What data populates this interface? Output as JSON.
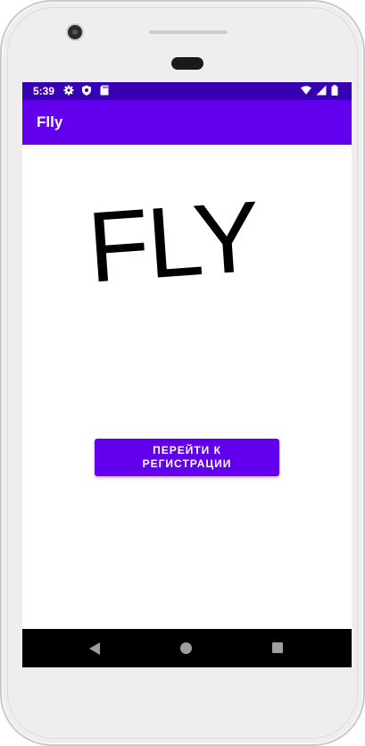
{
  "status_bar": {
    "time": "5:39",
    "left_icons": [
      "gear-icon",
      "shield-icon",
      "sdcard-icon"
    ],
    "right_icons": [
      "wifi-icon",
      "signal-icon",
      "battery-icon"
    ],
    "background": "#3700b3"
  },
  "app_bar": {
    "title": "Flly",
    "background": "#6200ee"
  },
  "main": {
    "logo_text": "FLY",
    "register_button_label": "ПЕРЕЙТИ К РЕГИСТРАЦИИ",
    "button_color": "#6200ee"
  },
  "nav_bar": {
    "buttons": [
      "back-icon",
      "home-icon",
      "recents-icon"
    ]
  }
}
